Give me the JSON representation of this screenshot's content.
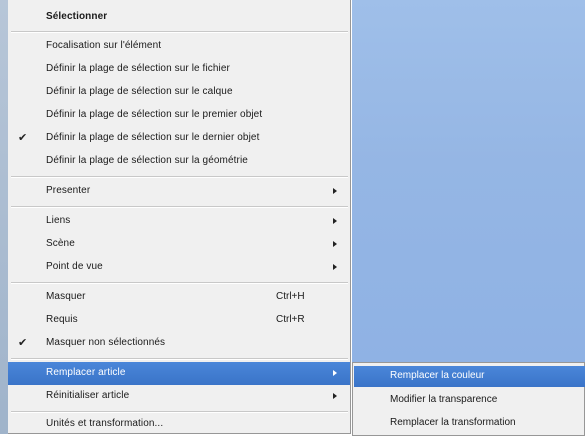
{
  "menu": {
    "title": "Sélectionner",
    "group1": [
      {
        "label": "Focalisation sur l'élément",
        "checked": false
      },
      {
        "label": "Définir la plage de sélection sur le fichier",
        "checked": false
      },
      {
        "label": "Définir la plage de sélection sur le calque",
        "checked": false
      },
      {
        "label": "Définir la plage de sélection sur le premier objet",
        "checked": false
      },
      {
        "label": "Définir la plage de sélection sur le dernier objet",
        "checked": true
      },
      {
        "label": "Définir la plage de sélection sur la géométrie",
        "checked": false
      }
    ],
    "presenter": "Presenter",
    "group2": [
      {
        "label": "Liens"
      },
      {
        "label": "Scène"
      },
      {
        "label": "Point de vue"
      }
    ],
    "group3": [
      {
        "label": "Masquer",
        "shortcut": "Ctrl+H"
      },
      {
        "label": "Requis",
        "shortcut": "Ctrl+R"
      },
      {
        "label": "Masquer non sélectionnés",
        "checked": true
      }
    ],
    "replace_item": "Remplacer article",
    "reset_item": "Réinitialiser article",
    "units_item": "Unités et transformation...",
    "check_glyph": "✔"
  },
  "submenu": {
    "items": [
      {
        "label": "Remplacer la couleur",
        "highlighted": true
      },
      {
        "label": "Modifier la transparence",
        "highlighted": false
      },
      {
        "label": "Remplacer la transformation",
        "highlighted": false
      }
    ]
  },
  "colors": {
    "menu_bg": "#f0f0f0",
    "highlight": "#3d7ad0",
    "desktop": "#95b6e4"
  }
}
